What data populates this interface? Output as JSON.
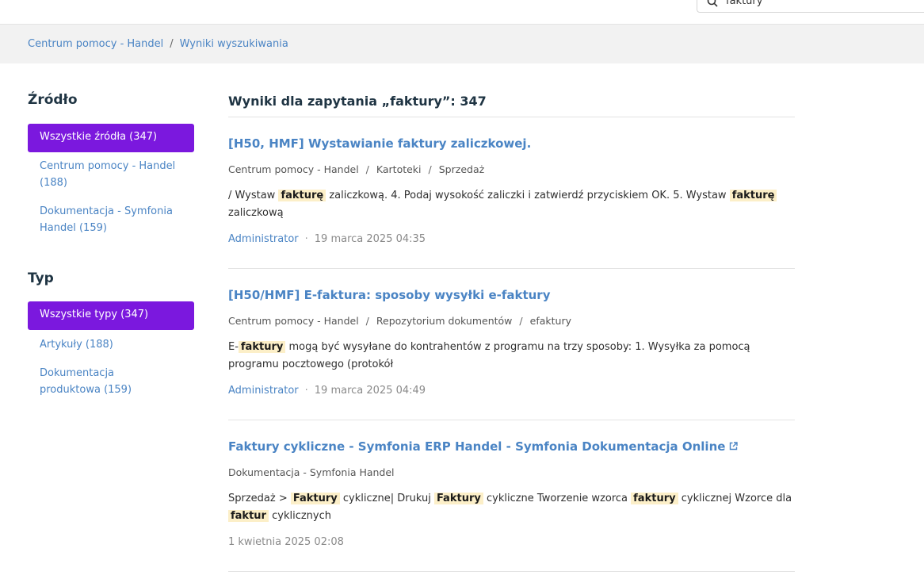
{
  "search": {
    "query": "faktury"
  },
  "breadcrumb": [
    "Centrum pomocy - Handel",
    "Wyniki wyszukiwania"
  ],
  "sidebar": {
    "source_title": "Źródło",
    "source_active": "Wszystkie źródła (347)",
    "source_items": [
      [
        "Centrum pomocy - Handel",
        "(188)"
      ],
      [
        "Dokumentacja - Symfonia",
        "Handel (159)"
      ]
    ],
    "type_title": "Typ",
    "type_active": "Wszystkie typy (347)",
    "type_items": [
      [
        "Artykuły (188)"
      ],
      [
        "Dokumentacja",
        "produktowa (159)"
      ]
    ]
  },
  "results_title": "Wyniki dla zapytania „faktury”: 347",
  "results": [
    {
      "title": "[H50, HMF] Wystawianie faktury zaliczkowej.",
      "path": [
        "Centrum pomocy - Handel",
        "Kartoteki",
        "Sprzedaż"
      ],
      "snippet": [
        [
          "/ Wystaw ",
          ""
        ],
        [
          "fakturę",
          "hl"
        ],
        [
          " zaliczkową. 4. Podaj wysokość zaliczki i zatwierdź przyciskiem OK. 5. Wystaw ",
          ""
        ],
        [
          "fakturę",
          "hl"
        ],
        [
          "",
          "br"
        ],
        [
          "zaliczkową",
          ""
        ]
      ],
      "author": "Administrator",
      "date": "19 marca 2025 04:35",
      "external": false
    },
    {
      "title": "[H50/HMF] E-faktura: sposoby wysyłki e-faktury",
      "path": [
        "Centrum pomocy - Handel",
        "Repozytorium dokumentów",
        "efaktury"
      ],
      "snippet": [
        [
          "E-",
          ""
        ],
        [
          "faktury",
          "hl"
        ],
        [
          " mogą być wysyłane do kontrahentów z programu na trzy sposoby: 1. Wysyłka za pomocą",
          ""
        ],
        [
          "",
          "br"
        ],
        [
          "programu pocztowego (protokół",
          ""
        ]
      ],
      "author": "Administrator",
      "date": "19 marca 2025 04:49",
      "external": false
    },
    {
      "title": "Faktury cykliczne - Symfonia ERP Handel - Symfonia Dokumentacja Online",
      "path": [
        "Dokumentacja - Symfonia Handel"
      ],
      "snippet": [
        [
          "Sprzedaż > ",
          ""
        ],
        [
          "Faktury",
          "hl"
        ],
        [
          " cykliczne| Drukuj ",
          ""
        ],
        [
          "Faktury",
          "hl"
        ],
        [
          " cykliczne Tworzenie wzorca ",
          ""
        ],
        [
          "faktury",
          "hl"
        ],
        [
          " cyklicznej Wzorce dla",
          ""
        ],
        [
          "",
          "br"
        ],
        [
          "faktur",
          "hl"
        ],
        [
          " cyklicznych",
          ""
        ]
      ],
      "author": "",
      "date": "1 kwietnia 2025 02:08",
      "external": true
    }
  ]
}
